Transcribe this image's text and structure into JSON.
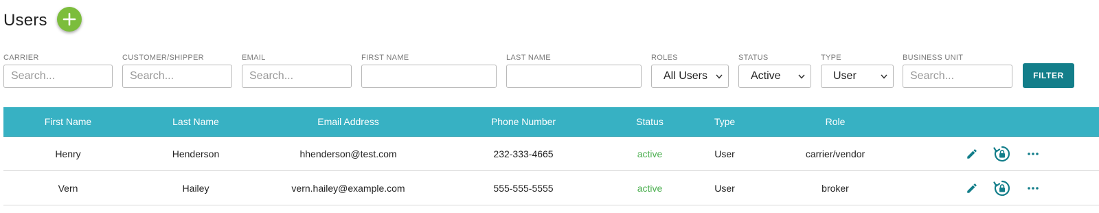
{
  "page": {
    "title": "Users"
  },
  "colors": {
    "accent": "#137e8a",
    "header_bg": "#37b1c3",
    "add_button": "#7cbd3c",
    "status_active": "#4caf50"
  },
  "filters": {
    "carrier": {
      "label": "CARRIER",
      "placeholder": "Search..."
    },
    "customer_shipper": {
      "label": "CUSTOMER/SHIPPER",
      "placeholder": "Search..."
    },
    "email": {
      "label": "EMAIL",
      "placeholder": "Search..."
    },
    "first_name": {
      "label": "FIRST NAME",
      "placeholder": ""
    },
    "last_name": {
      "label": "LAST NAME",
      "placeholder": ""
    },
    "roles": {
      "label": "ROLES",
      "value": "All Users"
    },
    "status": {
      "label": "STATUS",
      "value": "Active"
    },
    "type": {
      "label": "TYPE",
      "value": "User"
    },
    "business_unit": {
      "label": "BUSINESS UNIT",
      "placeholder": "Search..."
    },
    "filter_button": "FILTER"
  },
  "table": {
    "columns": [
      "First Name",
      "Last Name",
      "Email Address",
      "Phone Number",
      "Status",
      "Type",
      "Role"
    ],
    "rows": [
      {
        "first_name": "Henry",
        "last_name": "Henderson",
        "email": "hhenderson@test.com",
        "phone": "232-333-4665",
        "status": "active",
        "type": "User",
        "role": "carrier/vendor"
      },
      {
        "first_name": "Vern",
        "last_name": "Hailey",
        "email": "vern.hailey@example.com",
        "phone": "555-555-5555",
        "status": "active",
        "type": "User",
        "role": "broker"
      }
    ]
  },
  "icons": {
    "add": "plus-icon",
    "edit": "pencil-icon",
    "reset_password": "lock-reset-icon",
    "more": "more-horizontal-icon",
    "select": "chevron-down-icon"
  }
}
